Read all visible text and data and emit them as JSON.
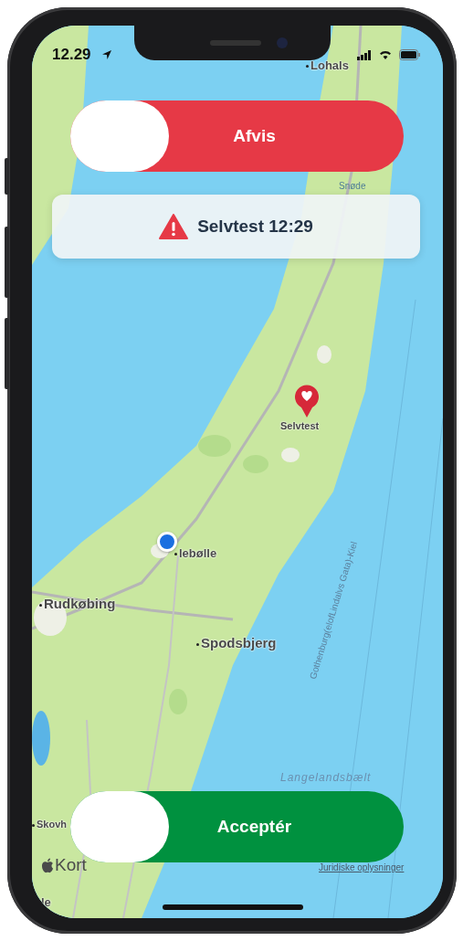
{
  "status_bar": {
    "time": "12.29"
  },
  "decline_slider": {
    "kind": "decline",
    "label": "Afvis",
    "level": 0
  },
  "alert_banner": {
    "text": "Selvtest 12:29"
  },
  "map": {
    "labels": [
      {
        "kind": "town",
        "text": "Lohals"
      },
      {
        "kind": "faint",
        "text": "Snøde"
      },
      {
        "kind": "town",
        "text": "lebølle"
      },
      {
        "kind": "town",
        "text": "Rudkøbing"
      },
      {
        "kind": "town",
        "text": "Spodsbjerg"
      },
      {
        "kind": "route",
        "text": "Gothenburg(elofLindalvs Gata)-Kiel"
      },
      {
        "kind": "water",
        "text": "Langelandsbælt"
      },
      {
        "kind": "town",
        "text": "Skovh"
      },
      {
        "kind": "town",
        "text": "le"
      }
    ],
    "pin": {
      "label": "Selvtest"
    },
    "attribution": "Kort",
    "legal_link": "Juridiske oplysninger"
  },
  "accept_slider": {
    "kind": "accept",
    "label": "Acceptér",
    "level": 0
  }
}
